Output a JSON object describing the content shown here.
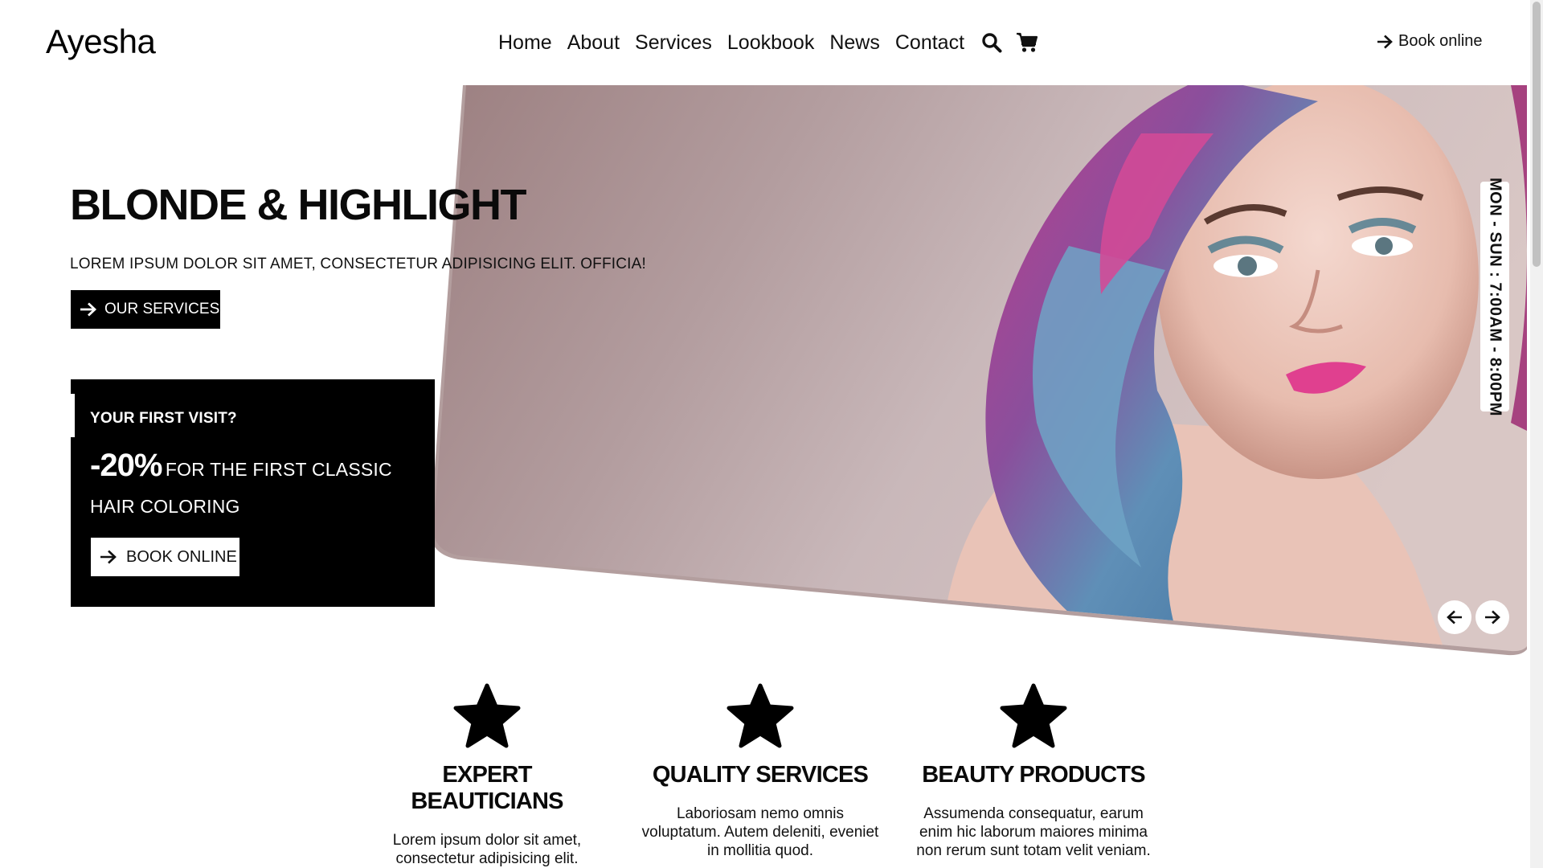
{
  "brand": {
    "logo": "Ayesha"
  },
  "nav": {
    "items": [
      "Home",
      "About",
      "Services",
      "Lookbook",
      "News",
      "Contact"
    ],
    "search_icon": "search-icon",
    "cart_icon": "cart-icon",
    "book_label": "Book online"
  },
  "hero": {
    "title": "BLONDE & HIGHLIGHT",
    "subtitle": "LOREM IPSUM DOLOR SIT AMET, CONSECTETUR ADIPISICING ELIT. OFFICIA!",
    "services_button": "OUR SERVICES",
    "hours": "MON - SUN : 7:00AM - 8:00PM"
  },
  "promo": {
    "question": "YOUR FIRST VISIT?",
    "discount": "-20%",
    "offer": "FOR THE FIRST CLASSIC HAIR COLORING",
    "button": "BOOK ONLINE"
  },
  "features": [
    {
      "title": "EXPERT BEAUTICIANS",
      "text": "Lorem ipsum dolor sit amet, consectetur adipisicing elit. Doloremque, exercitationem modi."
    },
    {
      "title": "QUALITY SERVICES",
      "text": "Laboriosam nemo omnis voluptatum. Autem deleniti, eveniet in mollitia quod."
    },
    {
      "title": "BEAUTY PRODUCTS",
      "text": "Assumenda consequatur, earum enim hic laborum maiores minima non rerum sunt totam velit veniam."
    }
  ],
  "colors": {
    "accent": "#000000",
    "background": "#ffffff"
  }
}
